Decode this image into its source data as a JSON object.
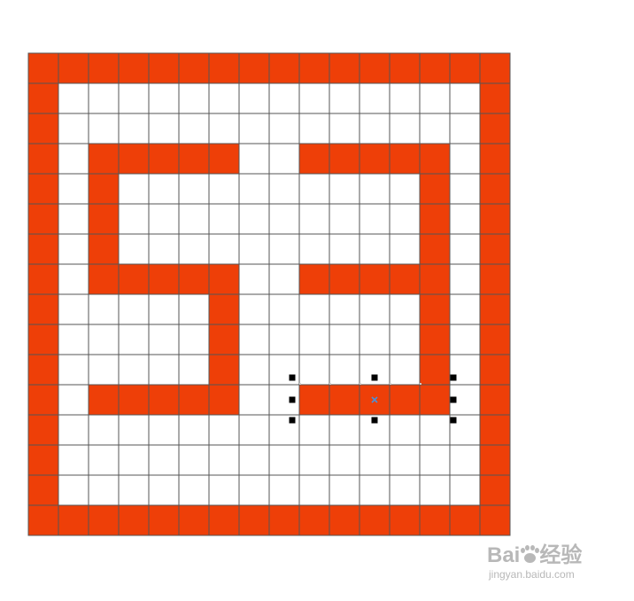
{
  "grid": {
    "rows": 16,
    "cols": 16,
    "fill_color": "#EE3F08",
    "line_color": "#555555",
    "empty_color": "#FFFFFF",
    "filled_cells": [
      "################",
      "#..............#",
      "#..............#",
      "#..#####..#####.#",
      "#..#......#...#.#",
      "#..#......#...#.#",
      "#..#......#...#.#",
      "#..######.#####.#",
      "#......#......#.#",
      "#......#......#.#",
      "#......#......#.#",
      "#..######..#####.#",
      "#..............#",
      "#..............#",
      "#..............#",
      "################"
    ]
  },
  "selection": {
    "shape": "rectangle",
    "handle_color": "#000000",
    "center_marker": "x-mark-icon",
    "center_color": "#4a90d9"
  },
  "watermark": {
    "logo_prefix": "Bai",
    "logo_suffix": "经验",
    "url": "jingyan.baidu.com",
    "icon": "paw-icon"
  }
}
